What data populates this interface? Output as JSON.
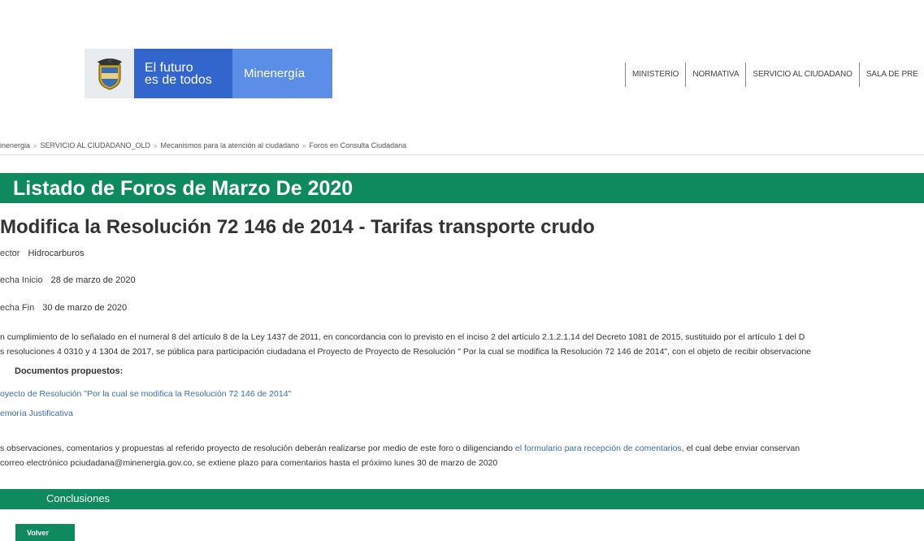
{
  "header": {
    "logo_line1": "El futuro",
    "logo_line2": "es de todos",
    "logo_ministry": "Minenergía",
    "nav": [
      "MINISTERIO",
      "NORMATIVA",
      "SERVICIO AL CIUDADANO",
      "SALA DE PRE"
    ]
  },
  "breadcrumb": [
    "inenergia",
    "SERVICIO AL CIUDADANO_OLD",
    "Mecanismos para la atención al ciudadano",
    "Foros en Consulta Ciudadana"
  ],
  "breadcrumb_separator": "»",
  "page_title": "Listado de Foros de Marzo De 2020",
  "forum": {
    "title": "Modifica la Resolución 72 146 de 2014 - Tarifas transporte crudo",
    "sector_label": "ector",
    "sector_value": "Hidrocarburos",
    "start_label": "echa Inicio",
    "start_value": "28 de marzo de 2020",
    "end_label": "echa Fin",
    "end_value": "30 de marzo de 2020",
    "description_line1": "n cumplimiento de lo señalado en el numeral 8 del artículo 8 de la Ley 1437 de 2011, en concordancia con lo previsto en el inciso 2 del artículo 2.1.2.1.14 del Decreto 1081 de 2015, sustituido por el artículo 1 del D",
    "description_line2": "s resoluciones 4 0310 y 4 1304 de 2017, se pública para participación ciudadana el Proyecto de Proyecto de Resolución \" Por la cual se modifica la Resolución 72 146 de 2014\", con el objeto de recibir observacione",
    "docs_heading": "Documentos propuestos:",
    "doc_link1": "oyecto de Resolución \"Por la cual se modifica la Resolución 72 146 de 2014\"",
    "doc_link2": "emoría Justificativa",
    "obs_line1_a": "s observaciones, comentarios y propuestas al referido proyecto de resolución deberán realizarse por medio de este foro o diligenciando ",
    "obs_line1_link": "el formulario para recepción de comentarios",
    "obs_line1_b": ", el cual debe enviar conservan",
    "obs_line2": "correo electrónico pciudadana@minenergia.gov.co, se extiene plazo para comentarios hasta  el próximo  lunes 30 de marzo de 2020"
  },
  "conclusions_label": "Conclusiones",
  "back_button": "Volver",
  "colors": {
    "green": "#0f8a5f",
    "blue_dark": "#3366cc",
    "blue_light": "#5b8ee6",
    "link": "#3b6db3"
  }
}
